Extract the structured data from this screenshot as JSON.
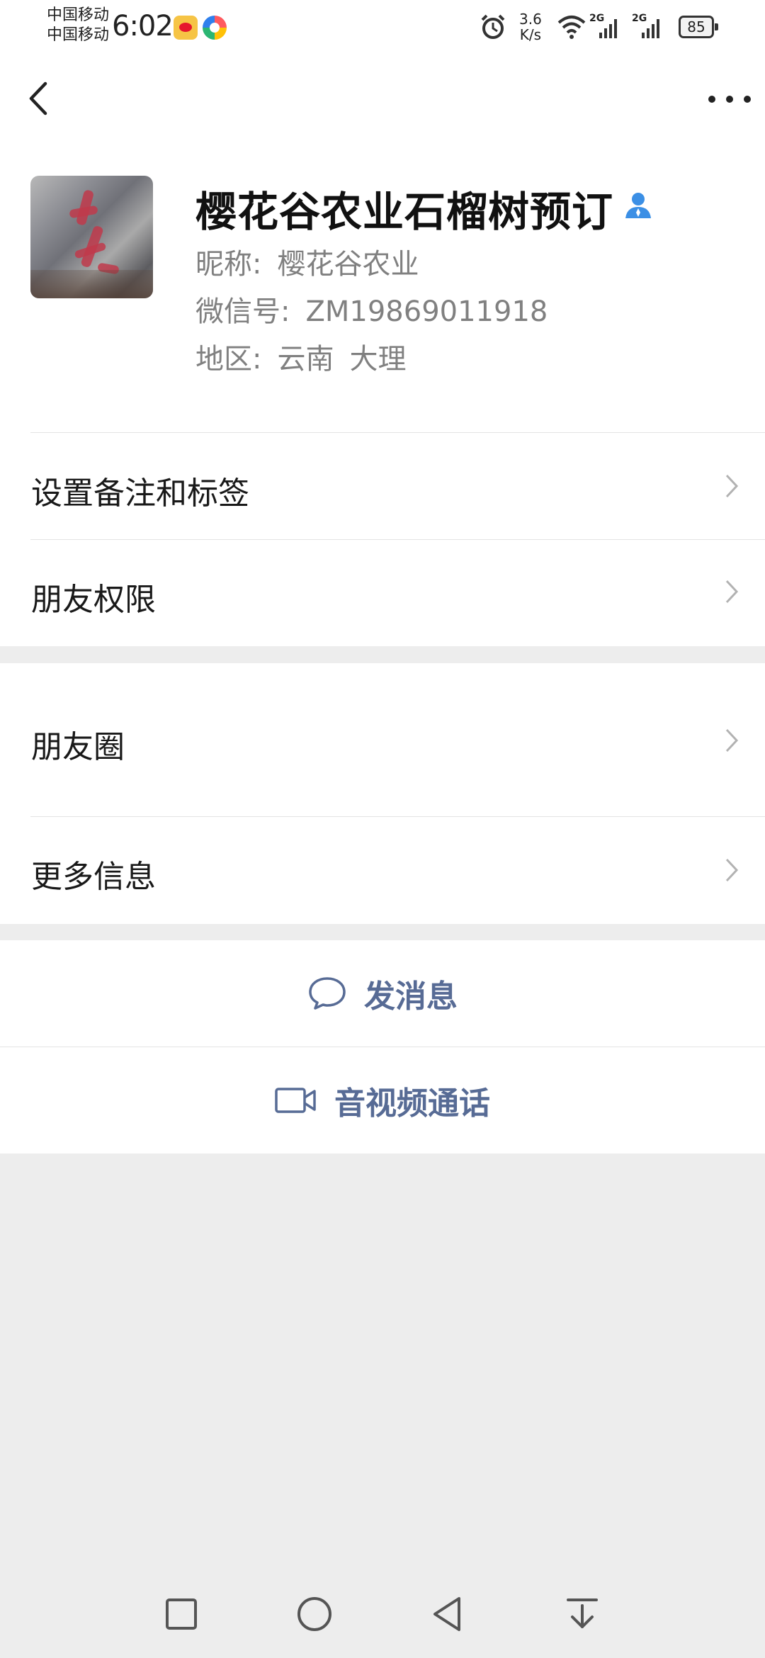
{
  "status_bar": {
    "carrier_1": "中国移动",
    "carrier_2": "中国移动",
    "time": "6:02",
    "net_speed_value": "3.6",
    "net_speed_unit": "K/s",
    "signal_1_tag": "2G",
    "signal_2_tag": "2G",
    "battery": "85",
    "icons": [
      "weibo-icon",
      "app-icon",
      "alarm-icon",
      "wifi-icon",
      "signal-icon",
      "signal-icon",
      "battery-icon"
    ]
  },
  "header": {
    "back_icon": "chevron-left-icon",
    "more_icon": "more-dots-icon"
  },
  "profile": {
    "title": "樱花谷农业石榴树预订",
    "nickname_label": "昵称:",
    "nickname_value": "樱花谷农业",
    "wechat_id_label": "微信号:",
    "wechat_id_value": "ZM19869011918",
    "region_label": "地区:",
    "region_province": "云南",
    "region_city": "大理",
    "contact_icon": "person-icon",
    "contact_icon_color": "#3b8fe5"
  },
  "menu": {
    "remark_tags": "设置备注和标签",
    "friend_permissions": "朋友权限",
    "moments": "朋友圈",
    "more_info": "更多信息"
  },
  "actions": {
    "send_message": "发消息",
    "av_call": "音视频通话",
    "accent_color": "#576b95"
  },
  "system_nav": {
    "icons": [
      "recent-apps-icon",
      "home-icon",
      "back-icon",
      "notification-pulldown-icon"
    ]
  }
}
